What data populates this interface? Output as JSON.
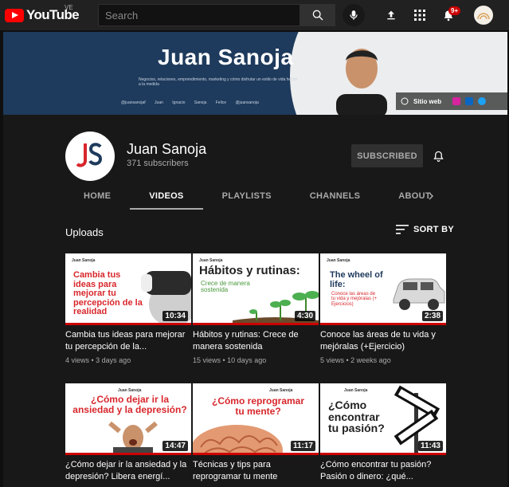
{
  "header": {
    "logo_text": "YouTube",
    "country_code": "VE",
    "search_placeholder": "Search",
    "notification_count": "9+",
    "icons": [
      "search-icon",
      "mic-icon",
      "upload-icon",
      "apps-grid-icon",
      "bell-icon",
      "avatar"
    ]
  },
  "banner": {
    "name": "Juan Sanoja",
    "tagline": "Negocios, relaciones, emprendimiento, marketing y cómo disfrutar un estilo de vida hecho a la medida",
    "handles": [
      "@juansanojaf",
      "Juan Ignacio Sanoja Felice",
      "@juansanoja"
    ],
    "site_link": "Sitio web"
  },
  "channel": {
    "avatar_initials": "JS",
    "name": "Juan Sanoja",
    "subscribers": "371 subscribers",
    "subscribe_label": "SUBSCRIBED",
    "tabs": [
      {
        "label": "HOME"
      },
      {
        "label": "VIDEOS"
      },
      {
        "label": "PLAYLISTS"
      },
      {
        "label": "CHANNELS"
      },
      {
        "label": "ABOUT"
      }
    ],
    "active_tab": "VIDEOS"
  },
  "content": {
    "section_title": "Uploads",
    "sort_label": "SORT BY",
    "videos": [
      {
        "thumb_brand": "Juan Sanoja",
        "thumb_text": "Cambia tus ideas para mejorar tu percepción de la realidad",
        "duration": "10:34",
        "title": "Cambia tus ideas para mejorar tu percepción de la...",
        "meta": "4 views • 3 days ago"
      },
      {
        "thumb_brand": "Juan Sanoja",
        "thumb_text": "Hábitos y rutinas:",
        "thumb_sub": "Crece de manera sostenida",
        "duration": "4:30",
        "title": "Hábitos y rutinas: Crece de manera sostenida",
        "meta": "15 views • 10 days ago"
      },
      {
        "thumb_brand": "Juan Sanoja",
        "thumb_text": "The wheel of life:",
        "thumb_sub": "Conoce las áreas de tu vida y mejóralas (+ Ejercicios)",
        "duration": "2:38",
        "title": "Conoce las áreas de tu vida y mejóralas (+Ejercicio)",
        "meta": "5 views • 2 weeks ago"
      },
      {
        "thumb_brand": "Juan Sanoja",
        "thumb_text": "¿Cómo dejar ir la ansiedad y la depresión?",
        "duration": "14:47",
        "title": "¿Cómo dejar ir la ansiedad y la depresión? Libera energí...",
        "meta": ""
      },
      {
        "thumb_brand": "Juan Sanoja",
        "thumb_text": "¿Cómo reprogramar tu mente?",
        "duration": "11:17",
        "title": "Técnicas y tips para reprogramar tu mente",
        "meta": ""
      },
      {
        "thumb_brand": "Juan Sanoja",
        "thumb_text": "¿Cómo encontrar tu pasión?",
        "duration": "11:43",
        "title": "¿Cómo encontrar tu pasión? Pasión o dinero: ¿qué...",
        "meta": ""
      }
    ]
  },
  "colors": {
    "brand_red": "#ff0000",
    "progress_red": "#cc0000",
    "banner_navy": "#1e3a5c",
    "thumb_red": "#d8262b"
  }
}
